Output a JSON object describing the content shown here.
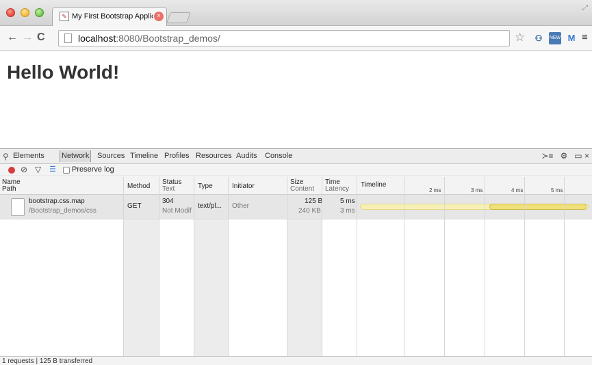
{
  "browser": {
    "tab_title": "My First Bootstrap Applica",
    "tab_favicon": "bootstrap-favicon",
    "url_host": "localhost",
    "url_path": ":8080/Bootstrap_demos/"
  },
  "page": {
    "heading": "Hello World!"
  },
  "devtools": {
    "tabs": [
      "Elements",
      "Network",
      "Sources",
      "Timeline",
      "Profiles",
      "Resources",
      "Audits",
      "Console"
    ],
    "active_tab": "Network",
    "preserve_log_label": "Preserve log",
    "preserve_log_checked": false,
    "columns": {
      "name": "Name",
      "path": "Path",
      "method": "Method",
      "status": "Status",
      "status_text": "Text",
      "type": "Type",
      "initiator": "Initiator",
      "size": "Size",
      "content": "Content",
      "time": "Time",
      "latency": "Latency",
      "timeline": "Timeline"
    },
    "ticks": [
      "2 ms",
      "3 ms",
      "4 ms",
      "5 ms"
    ],
    "row": {
      "name": "bootstrap.css.map",
      "path": "/Bootstrap_demos/css",
      "method": "GET",
      "status": "304",
      "status_text": "Not Modif",
      "type": "text/pl...",
      "initiator": "Other",
      "size": "125 B",
      "content": "240 KB",
      "time": "5 ms",
      "latency": "3 ms"
    },
    "status_bar": "1 requests | 125 B transferred"
  },
  "colors": {
    "record": "#d73b3b",
    "timeline_bar": "#f0e07a"
  }
}
